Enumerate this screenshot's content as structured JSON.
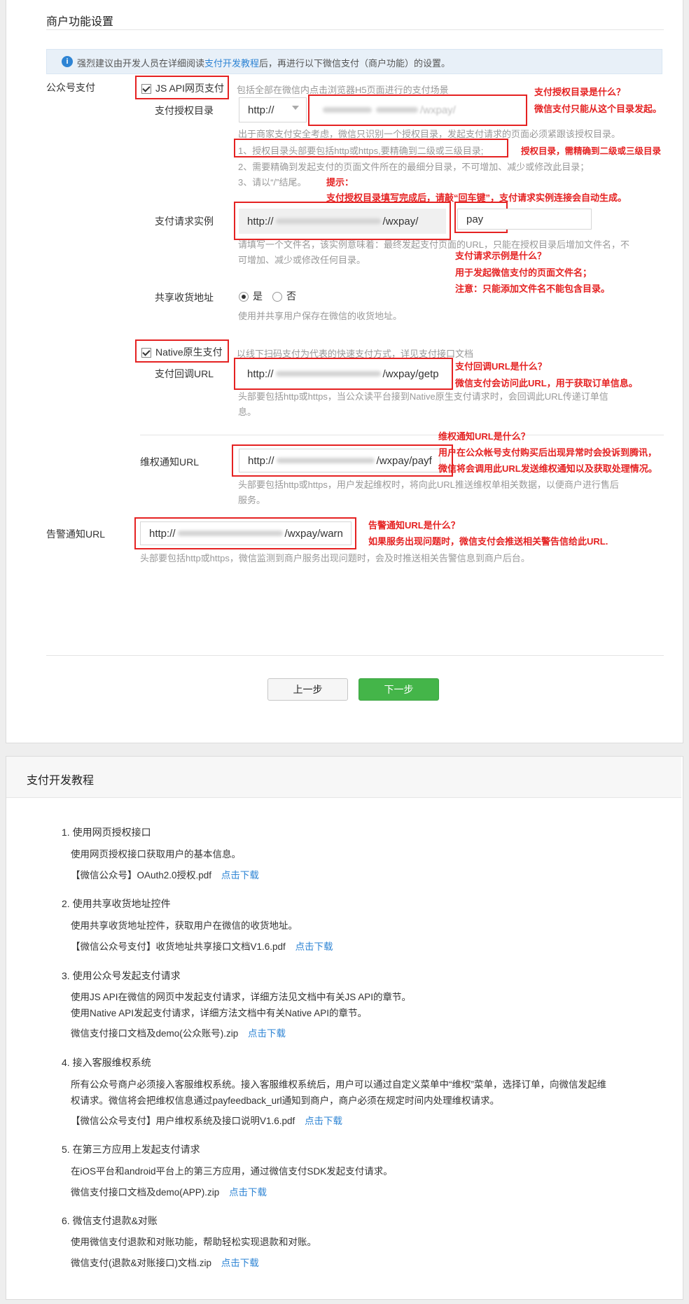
{
  "settings": {
    "title": "商户功能设置",
    "notice": {
      "prefix": "强烈建议由开发人员在详细阅读",
      "link": "支付开发教程",
      "suffix": "后，再进行以下微信支付（商户功能）的设置。"
    },
    "public_pay_label": "公众号支付",
    "jsapi": {
      "checkbox_label": "JS API网页支付",
      "checked": true,
      "desc": "包括全部在微信内点击浏览器H5页面进行的支付场景",
      "auth_dir_label": "支付授权目录",
      "protocol_value": "http://",
      "auth_dir_value": "/wxpay/",
      "hint1": "出于商家支付安全考虑，微信只识别一个授权目录，发起支付请求的页面必须紧跟该授权目录。",
      "hint2": "1、授权目录头部要包括http或https,要精确到二级或三级目录;",
      "hint3": "2、需要精确到发起支付的页面文件所在的最细分目录，不可增加、减少或修改此目录；",
      "hint4": "3、请以“/”结尾。",
      "request_label": "支付请求实例",
      "request_prefix": "http://",
      "request_suffix": "/wxpay/",
      "request_file": "pay",
      "request_hint1": "请填写一个文件名，该实例意味着：最终发起支付页面的URL，只能在授权目录后增加文件名，不",
      "request_hint2": "可增加、减少或修改任何目录。",
      "shared_address_label": "共享收货地址",
      "radio_yes": "是",
      "radio_no": "否",
      "shared_address_value": "是",
      "shared_hint": "使用并共享用户保存在微信的收货地址。"
    },
    "native": {
      "checkbox_label": "Native原生支付",
      "checked": true,
      "desc": "以线下扫码支付为代表的快速支付方式，详见支付接口文档",
      "callback_label": "支付回调URL",
      "callback_prefix": "http://",
      "callback_suffix": "/wxpay/getp",
      "hint1": "头部要包括http或https，当公众读平台接到Native原生支付请求时，会回调此URL传递订单信",
      "hint2": "息。"
    },
    "rights": {
      "label": "维权通知URL",
      "prefix": "http://",
      "suffix": "/wxpay/payf",
      "hint1": "头部要包括http或https，用户发起维权时，将向此URL推送维权单相关数据，以便商户进行售后",
      "hint2": "服务。"
    },
    "warn": {
      "label": "告警通知URL",
      "prefix": "http://",
      "suffix": "/wxpay/warn",
      "hint": "头部要包括http或https，微信监测到商户服务出现问题时，会及时推送相关告警信息到商户后台。"
    },
    "prev_button": "上一步",
    "next_button": "下一步"
  },
  "annotations": {
    "a1_title": "支付授权目录是什么？",
    "a1_body": "微信支付只能从这个目录发起。",
    "a2": "授权目录，需精确到二级或三级目录",
    "a3_title": "提示：",
    "a3_body": "支付授权目录填写完成后，请敲“回车键”，支付请求实例连接会自动生成。",
    "a4_title": "支付请求示例是什么？",
    "a4_line1": "用于发起微信支付的页面文件名；",
    "a4_line2": "注意：只能添加文件名不能包含目录。",
    "a5_title": "支付回调URL是什么？",
    "a5_body": "微信支付会访问此URL，用于获取订单信息。",
    "a6_title": "维权通知URL是什么？",
    "a6_line1": "用户在公众帐号支付购买后出现异常时会投诉到腾讯，",
    "a6_line2": "微信将会调用此URL发送维权通知以及获取处理情况。",
    "a7_title": "告警通知URL是什么？",
    "a7_body": "如果服务出现问题时，微信支付会推送相关警告信给此URL."
  },
  "tutorial": {
    "title": "支付开发教程",
    "download": "点击下载",
    "items": [
      {
        "title": "1. 使用网页授权接口",
        "desc1": "使用网页授权接口获取用户的基本信息。",
        "desc2": "",
        "file": "【微信公众号】OAuth2.0授权.pdf"
      },
      {
        "title": "2. 使用共享收货地址控件",
        "desc1": "使用共享收货地址控件，获取用户在微信的收货地址。",
        "desc2": "",
        "file": "【微信公众号支付】收货地址共享接口文档V1.6.pdf"
      },
      {
        "title": "3. 使用公众号发起支付请求",
        "desc1": "使用JS API在微信的网页中发起支付请求，详细方法见文档中有关JS API的章节。",
        "desc2": "使用Native API发起支付请求，详细方法文档中有关Native API的章节。",
        "file": "微信支付接口文档及demo(公众账号).zip"
      },
      {
        "title": "4. 接入客服维权系统",
        "desc1": "所有公众号商户必须接入客服维权系统。接入客服维权系统后，用户可以通过自定义菜单中“维权”菜单，选择订单，向微信发起维",
        "desc2": "权请求。微信将会把维权信息通过payfeedback_url通知到商户，商户必须在规定时间内处理维权请求。",
        "file": "【微信公众号支付】用户维权系统及接口说明V1.6.pdf"
      },
      {
        "title": "5. 在第三方应用上发起支付请求",
        "desc1": "在iOS平台和android平台上的第三方应用，通过微信支付SDK发起支付请求。",
        "desc2": "",
        "file": "微信支付接口文档及demo(APP).zip"
      },
      {
        "title": "6. 微信支付退款&对账",
        "desc1": "使用微信支付退款和对账功能，帮助轻松实现退款和对账。",
        "desc2": "",
        "file": "微信支付(退款&对账接口)文档.zip"
      }
    ]
  },
  "colors": {
    "accent": "#2e84d4",
    "primary_button": "#44b549",
    "annotation": "#e52222"
  }
}
